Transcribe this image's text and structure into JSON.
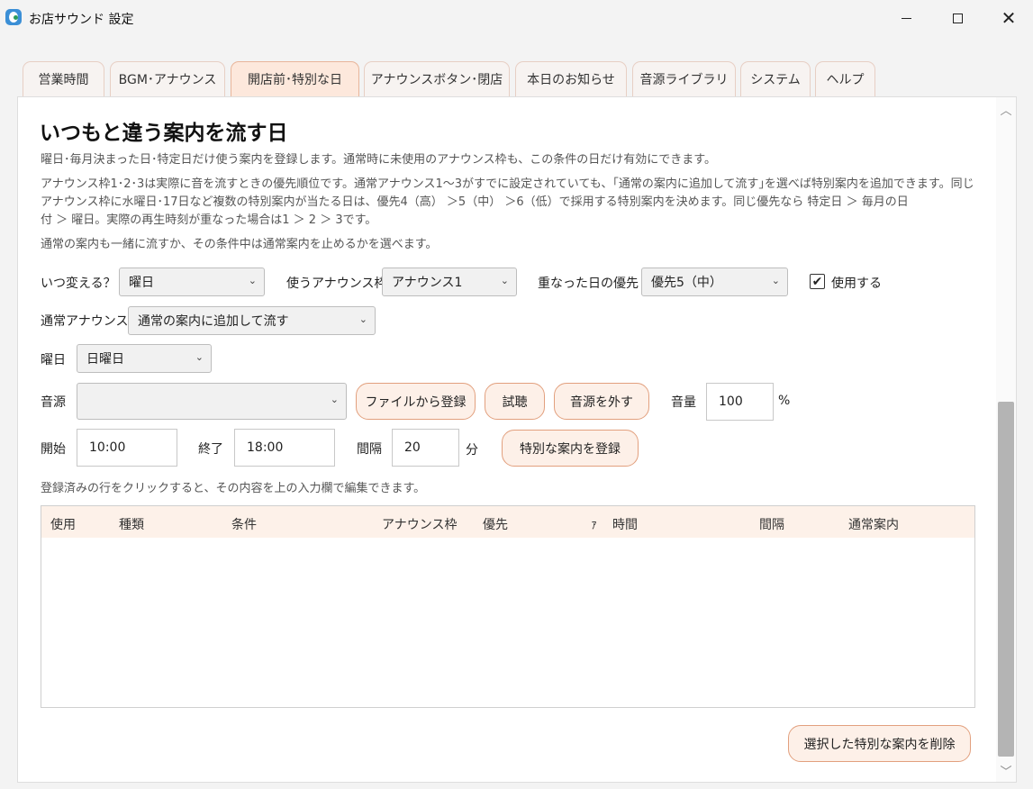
{
  "window": {
    "title": "お店サウンド 設定",
    "minimize_glyph": "",
    "close_glyph": "✕"
  },
  "tabs": [
    {
      "label": "営業時間"
    },
    {
      "label": "BGM･アナウンス"
    },
    {
      "label": "開店前･特別な日"
    },
    {
      "label": "アナウンスボタン･閉店"
    },
    {
      "label": "本日のお知らせ"
    },
    {
      "label": "音源ライブラリ"
    },
    {
      "label": "システム"
    },
    {
      "label": "ヘルプ"
    }
  ],
  "active_tab_index": 2,
  "section": {
    "heading": "いつもと違う案内を流す日",
    "desc1": "曜日･毎月決まった日･特定日だけ使う案内を登録します。通常時に未使用のアナウンス枠も、この条件の日だけ有効にできます。",
    "desc2_line1": "アナウンス枠1･2･3は実際に音を流すときの優先順位です。通常アナウンス1〜3がすでに設定されていても、｢通常の案内に追加して流す｣を選べば特別案内を追加できます。同じ",
    "desc2_line2": "アナウンス枠に水曜日･17日など複数の特別案内が当たる日は、優先4（高）  ＞5（中）  ＞6（低）で採用する特別案内を決めます。同じ優先なら 特定日 ＞ 毎月の日",
    "desc2_line3": "付 ＞ 曜日。実際の再生時刻が重なった場合は1 ＞ 2 ＞ 3です。",
    "desc3": "通常の案内も一緒に流すか、その条件中は通常案内を止めるかを選べます。"
  },
  "form": {
    "when_label": "いつ変える？",
    "when_value": "曜日",
    "slot_label": "使うアナウンス枠",
    "slot_value": "アナウンス1",
    "priority_label": "重なった日の優先",
    "priority_value": "優先5（中）",
    "use_label": "使用する",
    "use_checked": true,
    "use_check_glyph": "✔",
    "normal_label": "通常アナウンス",
    "normal_value": "通常の案内に追加して流す",
    "weekday_label": "曜日",
    "weekday_value": "日曜日",
    "source_label": "音源",
    "source_value": "",
    "register_file_button": "ファイルから登録",
    "preview_button": "試聴",
    "remove_source_button": "音源を外す",
    "volume_label": "音量",
    "volume_value": "100",
    "volume_unit": "%",
    "start_label": "開始",
    "start_value": "10:00",
    "end_label": "終了",
    "end_value": "18:00",
    "interval_label": "間隔",
    "interval_value": "20",
    "interval_unit": "分",
    "register_special_button": "特別な案内を登録",
    "hint": "登録済みの行をクリックすると、その内容を上の入力欄で編集できます。"
  },
  "table": {
    "columns": [
      "使用",
      "種類",
      "条件",
      "アナウンス枠",
      "優先",
      "ｧ",
      "時間",
      "間隔",
      "通常案内"
    ],
    "rows": []
  },
  "delete_button": "選択した特別な案内を削除",
  "icons": {
    "dropdown": "⌄",
    "scroll_up": "︿",
    "scroll_down": "﹀"
  }
}
